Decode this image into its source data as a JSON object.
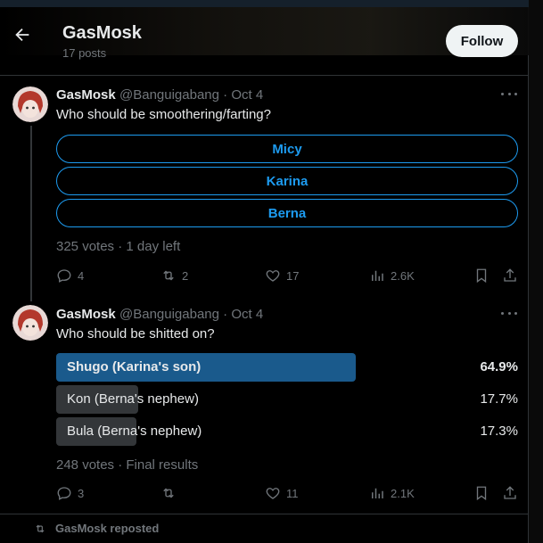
{
  "header": {
    "title": "GasMosk",
    "post_count": "17 posts",
    "follow_label": "Follow"
  },
  "posts": [
    {
      "name": "GasMosk",
      "handle_date": "@Banguigabang · Oct 4",
      "text": "Who should be smoothering/farting?",
      "poll_choices": [
        "Micy",
        "Karina",
        "Berna"
      ],
      "poll_meta": "325 votes · 1 day left",
      "actions": {
        "replies": "4",
        "reposts": "2",
        "likes": "17",
        "views": "2.6K"
      }
    },
    {
      "name": "GasMosk",
      "handle_date": "@Banguigabang · Oct 4",
      "text": "Who should be shitted on?",
      "poll_results": [
        {
          "label": "Shugo (Karina's son)",
          "percent": "64.9%",
          "fraction": 0.649,
          "leading": true
        },
        {
          "label": "Kon (Berna's nephew)",
          "percent": "17.7%",
          "fraction": 0.177,
          "leading": false
        },
        {
          "label": "Bula (Berna's nephew)",
          "percent": "17.3%",
          "fraction": 0.173,
          "leading": false
        }
      ],
      "poll_meta": "248 votes · Final results",
      "actions": {
        "replies": "3",
        "reposts": "",
        "likes": "11",
        "views": "2.1K"
      }
    }
  ],
  "repost_banner": "GasMosk reposted",
  "colors": {
    "accent": "#1d9bf0",
    "leading_bar": "#1a5a8c",
    "other_bar": "#333639",
    "muted": "#71767b"
  },
  "icons": [
    "arrow-left-icon",
    "more-icon",
    "reply-icon",
    "repost-icon",
    "like-icon",
    "views-icon",
    "bookmark-icon",
    "share-icon"
  ]
}
